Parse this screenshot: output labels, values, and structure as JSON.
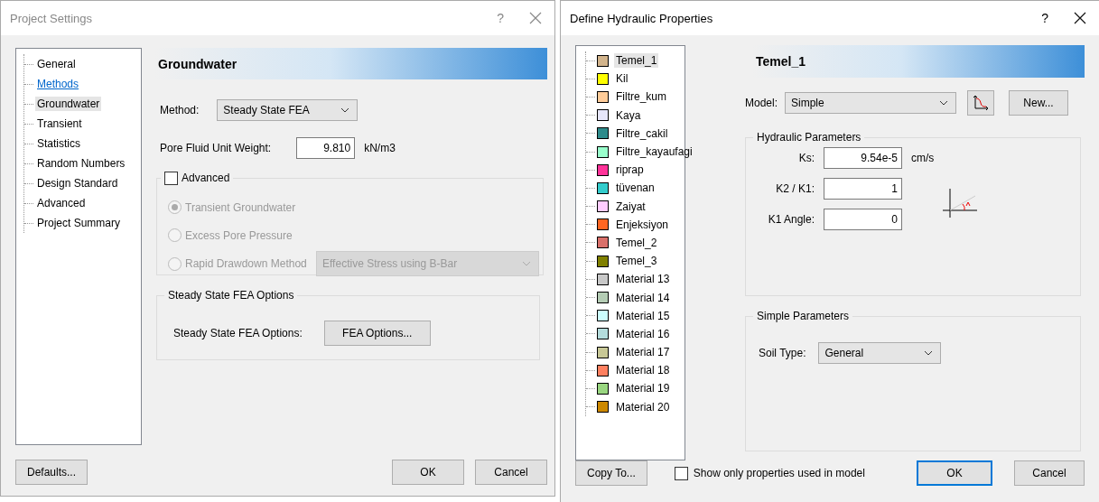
{
  "project_settings": {
    "title": "Project Settings",
    "help": "?",
    "tree": [
      {
        "label": "General",
        "kind": "item",
        "selected": false
      },
      {
        "label": "Methods",
        "kind": "link",
        "selected": false
      },
      {
        "label": "Groundwater",
        "kind": "item",
        "selected": true
      },
      {
        "label": "Transient",
        "kind": "item",
        "selected": false
      },
      {
        "label": "Statistics",
        "kind": "item",
        "selected": false
      },
      {
        "label": "Random Numbers",
        "kind": "item",
        "selected": false
      },
      {
        "label": "Design Standard",
        "kind": "item",
        "selected": false
      },
      {
        "label": "Advanced",
        "kind": "item",
        "selected": false
      },
      {
        "label": "Project Summary",
        "kind": "item",
        "selected": false
      }
    ],
    "header": "Groundwater",
    "method": {
      "label": "Method:",
      "value": "Steady State FEA"
    },
    "unit_weight": {
      "label": "Pore Fluid Unit Weight:",
      "value": "9.810",
      "unit": "kN/m3"
    },
    "advanced": {
      "label": "Advanced",
      "checked": false
    },
    "options": [
      {
        "label": "Transient Groundwater",
        "selected": true,
        "disabled": true
      },
      {
        "label": "Excess Pore Pressure",
        "selected": false,
        "disabled": true
      },
      {
        "label": "Rapid Drawdown Method",
        "selected": false,
        "disabled": true
      }
    ],
    "drawdown_select": {
      "value": "Effective Stress using B-Bar",
      "disabled": true
    },
    "fea_group": {
      "title": "Steady State FEA Options",
      "label": "Steady State FEA Options:",
      "button": "FEA Options..."
    },
    "buttons": {
      "defaults": "Defaults...",
      "ok": "OK",
      "cancel": "Cancel"
    }
  },
  "hydraulic": {
    "title": "Define Hydraulic Properties",
    "help": "?",
    "materials": [
      {
        "name": "Temel_1",
        "color": "#d2b48c",
        "selected": true
      },
      {
        "name": "Kil",
        "color": "#ffff00",
        "selected": false
      },
      {
        "name": "Filtre_kum",
        "color": "#ffcc99",
        "selected": false
      },
      {
        "name": "Kaya",
        "color": "#e6e6fa",
        "selected": false
      },
      {
        "name": "Filtre_cakil",
        "color": "#2e8b8b",
        "selected": false
      },
      {
        "name": "Filtre_kayaufagi",
        "color": "#99ffcc",
        "selected": false
      },
      {
        "name": "riprap",
        "color": "#ff3399",
        "selected": false
      },
      {
        "name": "tüvenan",
        "color": "#33cccc",
        "selected": false
      },
      {
        "name": "Zaiyat",
        "color": "#ffccff",
        "selected": false
      },
      {
        "name": "Enjeksiyon",
        "color": "#ff6622",
        "selected": false
      },
      {
        "name": "Temel_2",
        "color": "#d9706a",
        "selected": false
      },
      {
        "name": "Temel_3",
        "color": "#808000",
        "selected": false
      },
      {
        "name": "Material 13",
        "color": "#c8c8c8",
        "selected": false
      },
      {
        "name": "Material 14",
        "color": "#b4ccb4",
        "selected": false
      },
      {
        "name": "Material 15",
        "color": "#ccffff",
        "selected": false
      },
      {
        "name": "Material 16",
        "color": "#b4dcdc",
        "selected": false
      },
      {
        "name": "Material 17",
        "color": "#c8c896",
        "selected": false
      },
      {
        "name": "Material 18",
        "color": "#ff8060",
        "selected": false
      },
      {
        "name": "Material 19",
        "color": "#99d680",
        "selected": false
      },
      {
        "name": "Material 20",
        "color": "#cc8800",
        "selected": false
      }
    ],
    "header": "Temel_1",
    "model": {
      "label": "Model:",
      "value": "Simple",
      "new_button": "New..."
    },
    "hydraulic_group": {
      "title": "Hydraulic Parameters",
      "fields": [
        {
          "label": "Ks:",
          "value": "9.54e-5",
          "unit": "cm/s"
        },
        {
          "label": "K2 / K1:",
          "value": "1"
        },
        {
          "label": "K1 Angle:",
          "value": "0"
        }
      ]
    },
    "simple_group": {
      "title": "Simple Parameters",
      "label": "Soil Type:",
      "value": "General"
    },
    "copy_to": "Copy To...",
    "show_only": {
      "label": "Show only properties used in model",
      "checked": false
    },
    "buttons": {
      "ok": "OK",
      "cancel": "Cancel"
    }
  }
}
